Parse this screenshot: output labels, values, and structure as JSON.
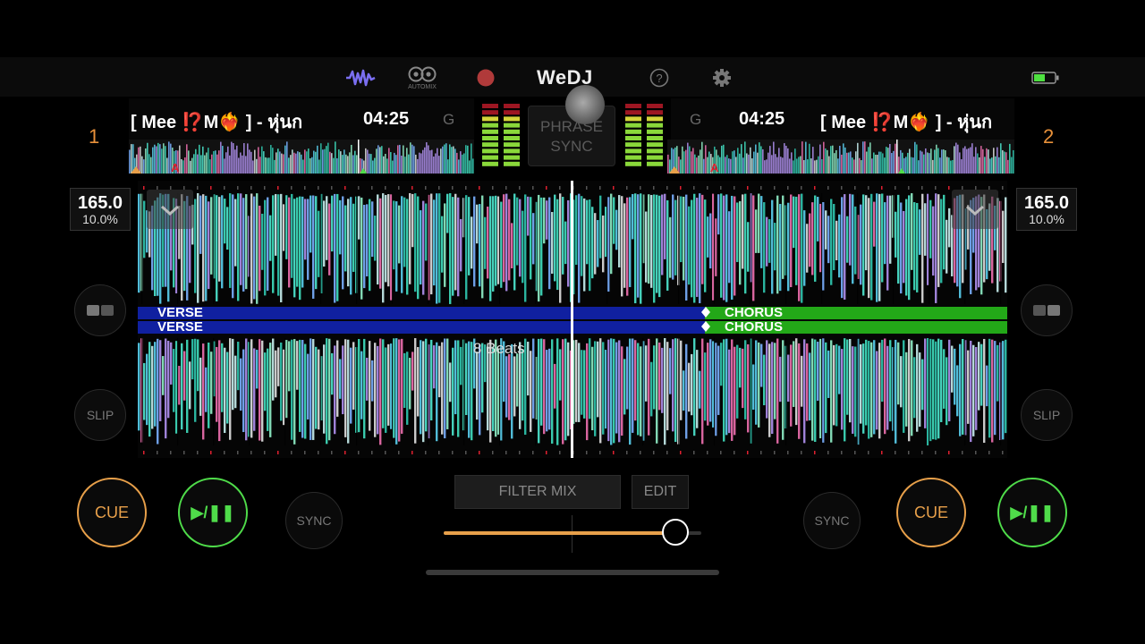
{
  "app": {
    "logo": "WeDJ",
    "automix_label": "AUTOMIX"
  },
  "colors": {
    "accent_orange": "#e8a04a",
    "accent_green": "#4fdc4a",
    "wave_teal": "#40e0c0",
    "verse_blue": "#1020a0",
    "chorus_green": "#23a818",
    "phrase_marker_red": "#e02030"
  },
  "toolbar": {
    "icons": [
      "waveform-icon",
      "automix-icon",
      "record-icon",
      "help-icon",
      "gear-icon",
      "battery-icon"
    ]
  },
  "phrase_sync": {
    "line1": "PHRASE",
    "line2": "SYNC"
  },
  "decks": [
    {
      "number": "1",
      "title": "[ Mee ⁉️M❤️‍🔥 ] - หุ่นก",
      "time": "04:25",
      "key": "G",
      "bpm": "165.0",
      "pitch": "10.0%",
      "cue_label": "CUE",
      "play_label": "▶/❚❚",
      "sync_label": "SYNC",
      "slip_label": "SLIP",
      "marker": "A"
    },
    {
      "number": "2",
      "title": "[ Mee ⁉️M❤️‍🔥 ] - หุ่นก",
      "time": "04:25",
      "key": "G",
      "bpm": "165.0",
      "pitch": "10.0%",
      "cue_label": "CUE",
      "play_label": "▶/❚❚",
      "sync_label": "SYNC",
      "slip_label": "SLIP",
      "marker": "A"
    }
  ],
  "phrases": {
    "top": {
      "left": "VERSE",
      "right": "CHORUS"
    },
    "bottom": {
      "left": "VERSE",
      "right": "CHORUS"
    }
  },
  "beats_label": "8 Beats",
  "mixer": {
    "filter_mix_label": "FILTER MIX",
    "edit_label": "EDIT",
    "crossfader_position": 0.9
  }
}
